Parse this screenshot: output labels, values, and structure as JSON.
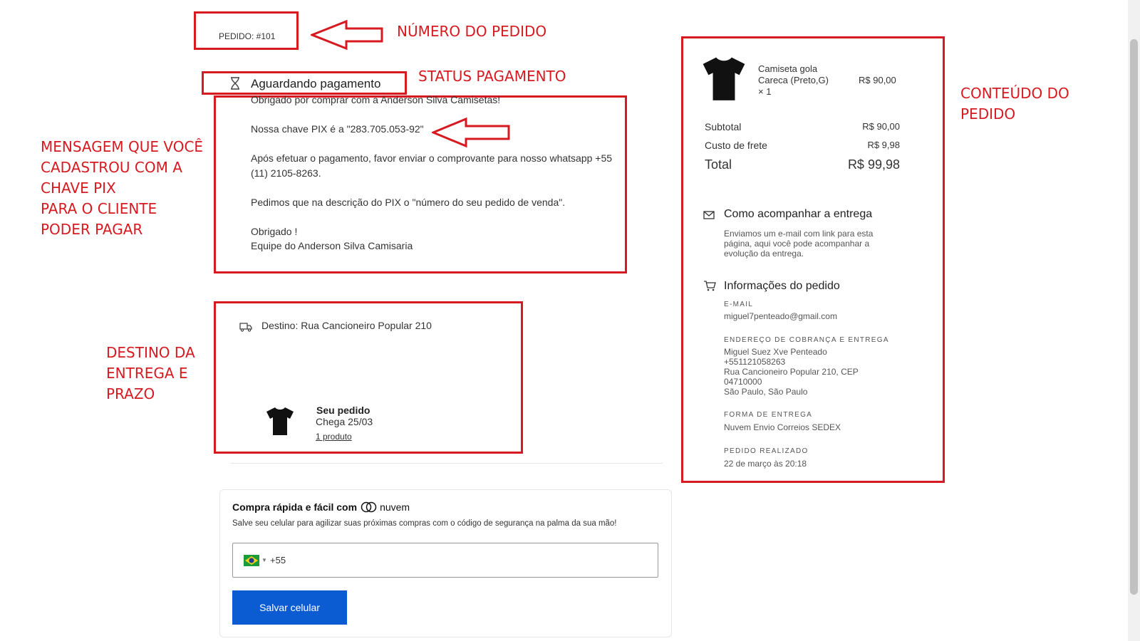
{
  "order": {
    "number_label": "PEDIDO: #101",
    "status": "Aguardando pagamento",
    "message": [
      "Obrigado por comprar com a Anderson Silva Camisetas!",
      "Nossa chave PIX é a \"283.705.053-92\"",
      "Após efetuar o pagamento, favor enviar o comprovante para nosso whatsapp +55 (11) 2105-8263.",
      "Pedimos que na descrição do PIX o \"número do seu pedido de venda\".",
      "Obrigado !",
      "Equipe do Anderson Silva Camisaria"
    ]
  },
  "delivery": {
    "destination": "Destino: Rua Cancioneiro Popular 210",
    "title": "Seu pedido",
    "eta": "Chega 25/03",
    "products_link": "1 produto"
  },
  "nuvem": {
    "title_prefix": "Compra rápida e fácil com",
    "brand": "nuvem",
    "subtitle": "Salve seu celular para agilizar suas próximas compras com o código de segurança na palma da sua mão!",
    "phone_code": "+55",
    "phone_placeholder": "",
    "save_button": "Salvar celular"
  },
  "summary": {
    "product_name": "Camiseta gola Careca (Preto,G)",
    "product_qty": "× 1",
    "product_price": "R$ 90,00",
    "subtotal_label": "Subtotal",
    "subtotal_value": "R$ 90,00",
    "shipping_label": "Custo de frete",
    "shipping_value": "R$ 9,98",
    "total_label": "Total",
    "total_value": "R$ 99,98",
    "tracking_title": "Como acompanhar a entrega",
    "tracking_text": "Enviamos um e-mail com link para esta página, aqui você pode acompanhar a evolução da entrega.",
    "info_title": "Informações do pedido",
    "email_label": "E-MAIL",
    "email_value": "miguel7penteado@gmail.com",
    "address_label": "ENDEREÇO DE COBRANÇA E ENTREGA",
    "address_lines": [
      "Miguel Suez Xve Penteado",
      "+551121058263",
      "Rua Cancioneiro Popular 210, CEP 04710000",
      "São Paulo, São Paulo"
    ],
    "shipping_method_label": "FORMA DE ENTREGA",
    "shipping_method_value": "Nuvem Envio Correios SEDEX",
    "placed_label": "PEDIDO REALIZADO",
    "placed_value": "22 de março às 20:18"
  },
  "annotations": {
    "order_number": "NÚMERO DO PEDIDO",
    "payment_status": "STATUS PAGAMENTO",
    "message": "MENSAGEM QUE VOCÊ\nCADASTROU COM A\nCHAVE PIX\nPARA O CLIENTE\nPODER PAGAR",
    "destination": "DESTINO DA\nENTREGA E\nPRAZO",
    "content": "CONTEÚDO DO\nPEDIDO"
  },
  "colors": {
    "annotation_red": "#d71920",
    "button_blue": "#0b5bd3"
  },
  "icons": [
    "hourglass-icon",
    "truck-icon",
    "tshirt-icon",
    "mail-icon",
    "cart-icon",
    "brazil-flag-icon",
    "nuvem-logo-icon"
  ]
}
